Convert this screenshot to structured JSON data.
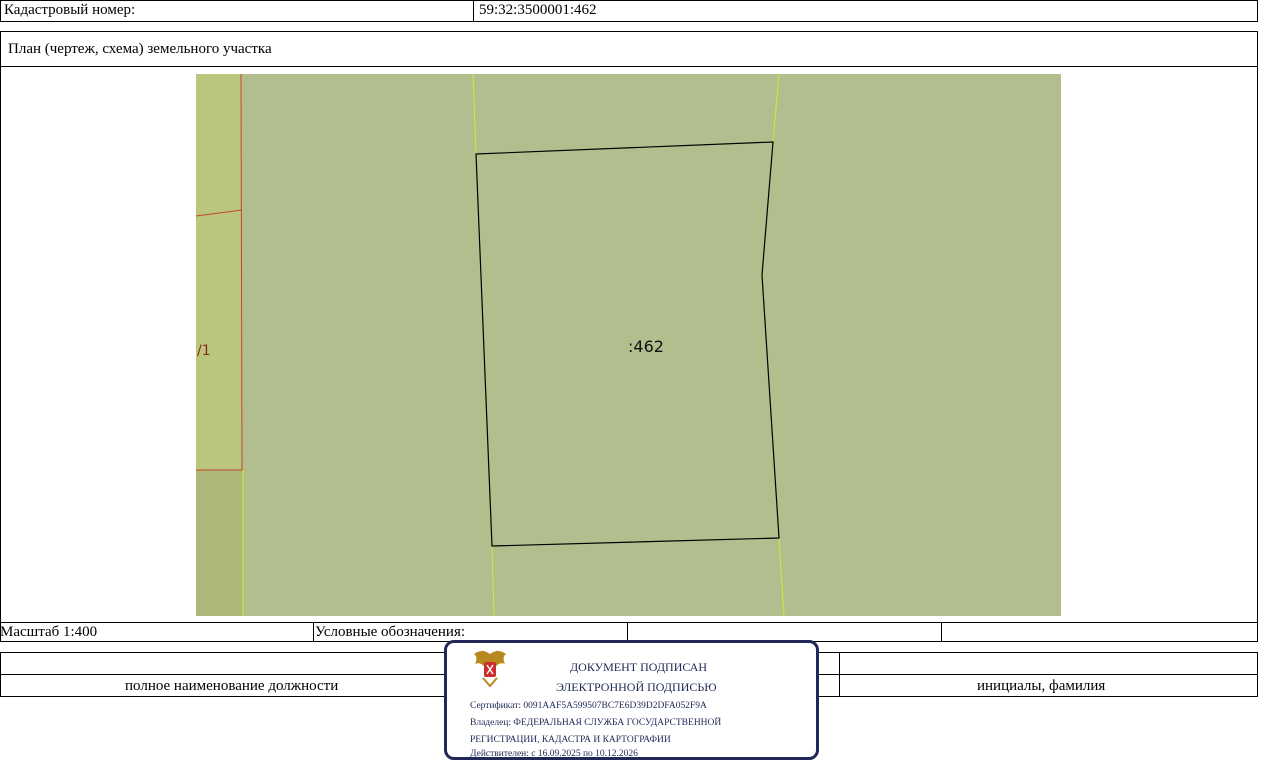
{
  "header": {
    "cadastral_label": "Кадастровый номер:",
    "cadastral_value": "59:32:3500001:462"
  },
  "plan": {
    "title": "План (чертеж, схема) земельного участка",
    "parcel_label": ":462",
    "neighbor_label": "/1",
    "colors": {
      "land": "#b3be8e",
      "strip": "#bac67d",
      "strip_dark": "#aeb87a",
      "boundary_red": "#c2462e",
      "boundary_yellow": "#d2ea2a"
    }
  },
  "scale_row": {
    "scale": "Масштаб 1:400",
    "legend": "Условные обозначения:"
  },
  "signature": {
    "position_caption": "полное наименование должности",
    "name_caption": "инициалы, фамилия"
  },
  "stamp": {
    "line1": "ДОКУМЕНТ ПОДПИСАН",
    "line2": "ЭЛЕКТРОННОЙ ПОДПИСЬЮ",
    "certificate": "Сертификат: 0091AAF5A599507BC7E6D39D2DFA052F9A",
    "owner_line1": "Владелец: ФЕДЕРАЛЬНАЯ СЛУЖБА ГОСУДАРСТВЕННОЙ",
    "owner_line2": "РЕГИСТРАЦИИ, КАДАСТРА И КАРТОГРАФИИ",
    "valid": "Действителен: с 16.09.2025 по 10.12.2026",
    "emblem_icon": "double-headed-eagle-emblem-icon",
    "color": "#1f2857"
  }
}
